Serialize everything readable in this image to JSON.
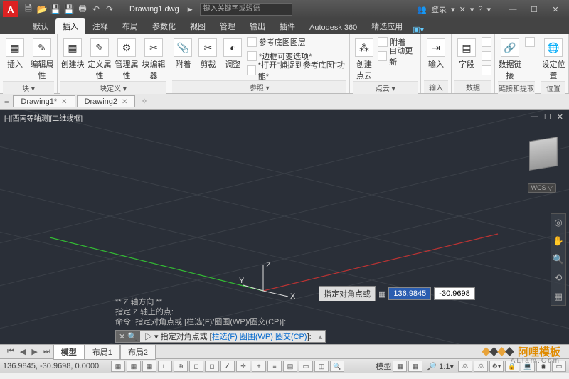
{
  "title": {
    "filename": "Drawing1.dwg",
    "search_placeholder": "键入关键字或短语",
    "login": "登录"
  },
  "tabs": [
    "默认",
    "插入",
    "注释",
    "布局",
    "参数化",
    "视图",
    "管理",
    "输出",
    "插件",
    "Autodesk 360",
    "精选应用"
  ],
  "active_tab": "插入",
  "ribbon": {
    "p1": {
      "btns": [
        "编辑属性"
      ],
      "title": "块 ▾"
    },
    "p2": {
      "btns": [
        "创建块",
        "定义属性",
        "管理属性",
        "块编辑器"
      ],
      "title": "块定义 ▾"
    },
    "p3": {
      "btns": [
        "附着",
        "剪裁",
        "调整"
      ],
      "rows": [
        "参考底图图层",
        "*边框可变选项*",
        "*打开\"捕捉到参考底图\"功能*"
      ],
      "title": "参照 ▾"
    },
    "p4": {
      "btns": [
        "创建点云"
      ],
      "rows": [
        "附着",
        "自动更新"
      ],
      "title": "点云 ▾"
    },
    "p5": {
      "btns": [
        "输入"
      ],
      "title": "输入"
    },
    "p6": {
      "btns": [
        "字段"
      ],
      "title": "数据"
    },
    "p7": {
      "btns": [
        "数据链接"
      ],
      "title": "链接和提取"
    },
    "p8": {
      "btns": [
        "设定位置"
      ],
      "title": "位置"
    }
  },
  "filetabs": [
    {
      "name": "Drawing1*",
      "closable": true
    },
    {
      "name": "Drawing2",
      "closable": true
    }
  ],
  "viewport": {
    "label": "[-][西南等轴测][二维线框]",
    "wcs": "WCS ▽",
    "dyn_label": "指定对角点或",
    "dyn_x": "136.9845",
    "dyn_y": "-30.9698",
    "axis_labels": {
      "x": "X",
      "y": "Y",
      "z": "Z"
    }
  },
  "cmd_history": [
    "** Z 轴方向 **",
    "指定 Z 轴上的点:",
    "命令: 指定对角点或 [栏选(F)/圈围(WP)/圈交(CP)]:"
  ],
  "cmdline": {
    "prompt": "▷ ▾ 指定对角点或 [",
    "f": "栏选(F)",
    "sep1": " ",
    "wp": "圈围(WP)",
    "sep2": " ",
    "cp": "圈交(CP)",
    "end": "]:"
  },
  "bottom_tabs": [
    "模型",
    "布局1",
    "布局2"
  ],
  "status": {
    "coords": "136.9845, -30.9698, 0.0000",
    "scale": "1:1",
    "modelspace": "模型"
  },
  "watermark": {
    "brand_cn": "阿哩模板",
    "url": "ALiam.Com"
  }
}
